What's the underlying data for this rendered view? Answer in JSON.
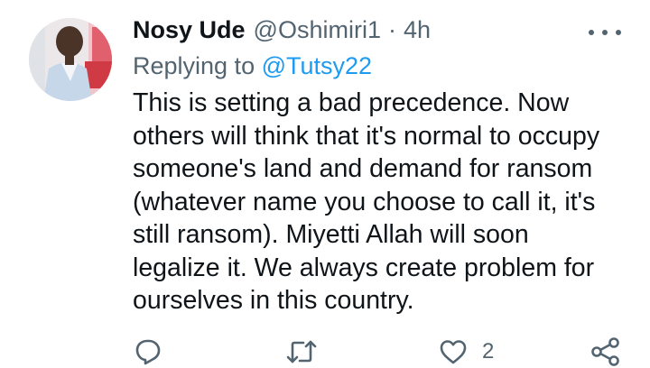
{
  "tweet": {
    "author_name": "Nosy Ude",
    "author_handle": "@Oshimiri1",
    "separator": "·",
    "time": "4h",
    "replying_prefix": "Replying to ",
    "replying_to": "@Tutsy22",
    "body_lines": [
      "This is setting a bad precedence. Now",
      "others will think that it's normal to occupy",
      "someone's land and demand for ransom",
      "(whatever name you choose to call it, it's",
      "still ransom). Miyetti Allah will soon",
      "legalize it. We always create problem for",
      "ourselves in this country."
    ]
  },
  "actions": {
    "reply_icon": "reply-icon",
    "retweet_icon": "retweet-icon",
    "like_icon": "heart-icon",
    "like_count": "2",
    "share_icon": "share-icon"
  },
  "colors": {
    "text": "#0f1419",
    "muted": "#536471",
    "link": "#1d9bf0"
  }
}
